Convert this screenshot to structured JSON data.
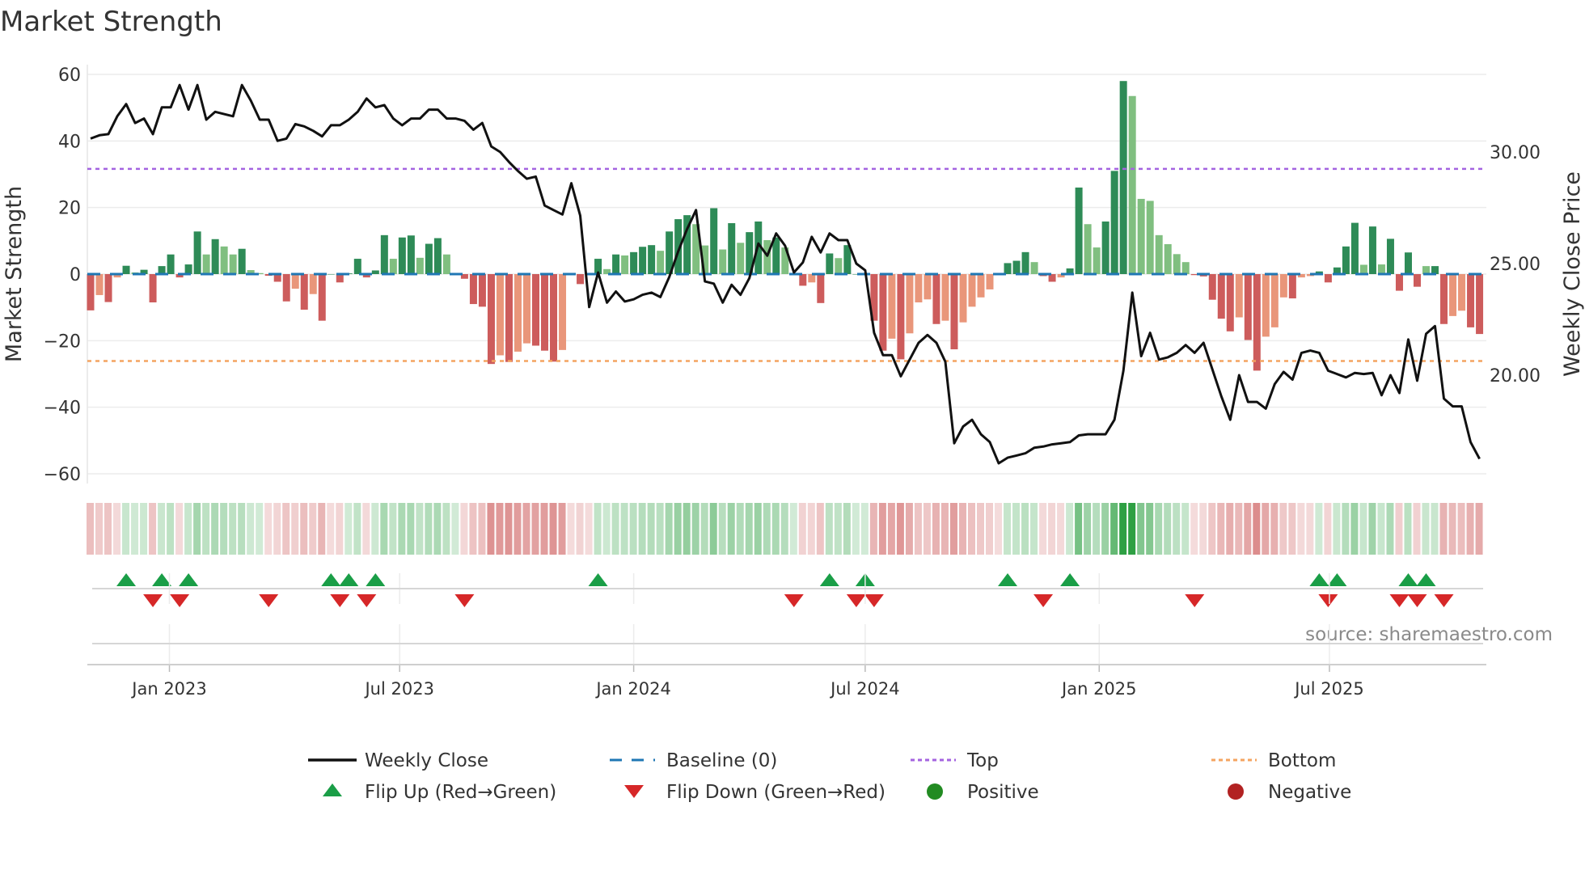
{
  "chart_data": {
    "type": "bar",
    "title": "Market Strength",
    "ylabel": "Market Strength",
    "y2label": "Weekly Close Price",
    "ylim": [
      -63,
      64
    ],
    "yticks": [
      60,
      40,
      20,
      0,
      -20,
      -40,
      -60
    ],
    "yticklabels": [
      "60",
      "40",
      "20",
      "0",
      "−20",
      "−40",
      "−60"
    ],
    "y2ticks": [
      30,
      25,
      20
    ],
    "y2ticklabels": [
      "30.00",
      "25.00",
      "20.00"
    ],
    "start_week": "2022-10-31",
    "xticks": [
      {
        "date": "2023-01-01",
        "label": "Jan 2023"
      },
      {
        "date": "2023-07-01",
        "label": "Jul 2023"
      },
      {
        "date": "2024-01-01",
        "label": "Jan 2024"
      },
      {
        "date": "2024-07-01",
        "label": "Jul 2024"
      },
      {
        "date": "2025-01-01",
        "label": "Jan 2025"
      },
      {
        "date": "2025-07-01",
        "label": "Jul 2025"
      }
    ],
    "top_threshold": 31.6,
    "bottom_threshold": -26.1,
    "strength": [
      -10.9,
      -6.3,
      -8.4,
      -1,
      2.5,
      0.5,
      1.3,
      -8.5,
      2.4,
      5.9,
      -1,
      2.9,
      12.8,
      5.9,
      10.5,
      8.3,
      5.9,
      7.6,
      1.2,
      0.3,
      -0.5,
      -2.3,
      -8.2,
      -4.4,
      -10.7,
      -6,
      -14,
      0,
      -2.5,
      0.2,
      4.6,
      -1,
      1.1,
      11.7,
      4.6,
      11,
      11.6,
      4.9,
      9.1,
      10.8,
      5.9,
      0,
      -1.4,
      -9,
      -9.8,
      -27,
      -24.4,
      -26.4,
      -23.3,
      -20.8,
      -21.5,
      -23,
      -26.3,
      -22.8,
      0,
      -3,
      0,
      4.6,
      1.5,
      5.9,
      5.6,
      6.6,
      8.2,
      8.7,
      7,
      12.8,
      16.5,
      17.7,
      15,
      8.6,
      19.8,
      7.4,
      15.3,
      9.4,
      12.6,
      15.8,
      10.2,
      11,
      8,
      0,
      -3.5,
      -2.5,
      -8.7,
      6.2,
      4.8,
      8.7,
      0,
      0,
      -14,
      -23,
      -19.4,
      -25.6,
      -17.8,
      -8.5,
      -7.6,
      -15,
      -14,
      -22.6,
      -14.5,
      -9.8,
      -7,
      -4.6,
      0,
      3.3,
      4,
      6.6,
      3.6,
      -0.6,
      -2.3,
      -1,
      1.7,
      26,
      15,
      8,
      15.8,
      31,
      58,
      53.5,
      22.6,
      22,
      11.7,
      9,
      6,
      3.6,
      -0.3,
      -0.7,
      -7.7,
      -13.4,
      -17.2,
      -13,
      -19.8,
      -29,
      -18.8,
      -16,
      -7,
      -7.3,
      -1,
      -0.6,
      0.8,
      -2.5,
      2,
      8.3,
      15.4,
      2.8,
      14.3,
      2.9,
      10.6,
      -5,
      6.5,
      -3.8,
      2.4,
      2.4,
      -15,
      -12.6,
      -11,
      -16,
      -18
    ],
    "light_shade": [
      0,
      1,
      0,
      1,
      0,
      1,
      0,
      0,
      0,
      0,
      0,
      0,
      0,
      1,
      0,
      1,
      1,
      0,
      1,
      1,
      0,
      0,
      0,
      1,
      0,
      1,
      0,
      0,
      0,
      0,
      0,
      0,
      0,
      0,
      1,
      0,
      0,
      1,
      0,
      0,
      1,
      0,
      0,
      0,
      0,
      0,
      1,
      0,
      1,
      1,
      0,
      0,
      0,
      1,
      0,
      0,
      0,
      0,
      1,
      0,
      1,
      0,
      0,
      0,
      1,
      0,
      0,
      0,
      1,
      1,
      0,
      1,
      0,
      1,
      0,
      0,
      1,
      0,
      1,
      0,
      0,
      1,
      0,
      0,
      1,
      0,
      0,
      0,
      0,
      0,
      1,
      0,
      1,
      1,
      1,
      0,
      1,
      0,
      1,
      1,
      1,
      1,
      1,
      0,
      0,
      0,
      1,
      0,
      0,
      1,
      0,
      0,
      1,
      1,
      0,
      0,
      0,
      1,
      1,
      1,
      1,
      1,
      1,
      1,
      0,
      0,
      0,
      0,
      0,
      1,
      0,
      0,
      1,
      1,
      1,
      0,
      1,
      1,
      0,
      0,
      0,
      0,
      0,
      1,
      0,
      1,
      0,
      0,
      0,
      0,
      1,
      0,
      0,
      1,
      1,
      0,
      0
    ],
    "weekly_close": [
      30.6,
      30.75,
      30.8,
      31.6,
      32.15,
      31.3,
      31.5,
      30.8,
      32.0,
      32.0,
      33.0,
      31.9,
      33.0,
      31.45,
      31.8,
      31.7,
      31.6,
      33.0,
      32.3,
      31.45,
      31.45,
      30.5,
      30.6,
      31.25,
      31.15,
      30.95,
      30.7,
      31.2,
      31.2,
      31.45,
      31.8,
      32.4,
      32.0,
      32.1,
      31.5,
      31.2,
      31.5,
      31.5,
      31.9,
      31.9,
      31.5,
      31.5,
      31.4,
      31.0,
      31.3,
      30.25,
      30.0,
      29.55,
      29.15,
      28.8,
      28.9,
      27.6,
      27.4,
      27.2,
      28.6,
      27.15,
      23.05,
      24.6,
      23.25,
      23.75,
      23.3,
      23.4,
      23.6,
      23.7,
      23.5,
      24.4,
      25.55,
      26.55,
      27.4,
      24.2,
      24.1,
      23.25,
      24.05,
      23.6,
      24.35,
      25.9,
      25.35,
      26.35,
      25.8,
      24.6,
      25.05,
      26.2,
      25.5,
      26.35,
      26.05,
      26.05,
      25.0,
      24.7,
      21.9,
      20.9,
      20.9,
      19.95,
      20.7,
      21.45,
      21.8,
      21.45,
      20.6,
      16.95,
      17.7,
      18.0,
      17.35,
      17.0,
      16.05,
      16.3,
      16.4,
      16.5,
      16.75,
      16.8,
      16.9,
      16.95,
      17.0,
      17.3,
      17.35,
      17.35,
      17.35,
      18.0,
      20.2,
      23.7,
      20.85,
      21.9,
      20.7,
      20.8,
      21.0,
      21.35,
      21.0,
      21.45,
      20.25,
      19.05,
      18.0,
      20.0,
      18.8,
      18.8,
      18.5,
      19.6,
      20.15,
      19.8,
      21.0,
      21.1,
      21.0,
      20.2,
      20.05,
      19.9,
      20.1,
      20.05,
      20.1,
      19.1,
      20.0,
      19.2,
      21.6,
      19.75,
      21.85,
      22.2,
      18.95,
      18.6,
      18.6,
      17.0,
      16.25
    ],
    "flip_up_weeks": [
      5,
      9,
      12,
      28,
      30,
      33,
      58,
      84,
      88,
      104,
      111,
      139,
      141,
      149,
      151
    ],
    "flip_down_weeks": [
      8,
      11,
      21,
      29,
      32,
      43,
      80,
      87,
      89,
      108,
      125,
      140,
      148,
      150,
      153
    ],
    "legend": [
      {
        "label": "Weekly Close",
        "symbol": "line"
      },
      {
        "label": "Baseline (0)",
        "symbol": "dash"
      },
      {
        "label": "Top",
        "symbol": "dot-purple"
      },
      {
        "label": "Bottom",
        "symbol": "dot-orange"
      },
      {
        "label": "Flip Up (Red→Green)",
        "symbol": "tri-up"
      },
      {
        "label": "Flip Down (Green→Red)",
        "symbol": "tri-down"
      },
      {
        "label": "Positive",
        "symbol": "circle-green"
      },
      {
        "label": "Negative",
        "symbol": "circle-red"
      }
    ],
    "legend_placement": "bottom",
    "source": "source: sharemaestro.com"
  },
  "colors": {
    "pos_dark": "#2e8b57",
    "pos_light": "#80bf80",
    "neg_dark": "#cd5c5c",
    "neg_light": "#e9967a",
    "baseline": "#1f77b4",
    "top": "#a463e0",
    "bottom": "#f4a460",
    "close": "#111111",
    "flip_up": "#1a9e47",
    "flip_down": "#d62728",
    "positive": "#228b22",
    "negative": "#b22222"
  }
}
